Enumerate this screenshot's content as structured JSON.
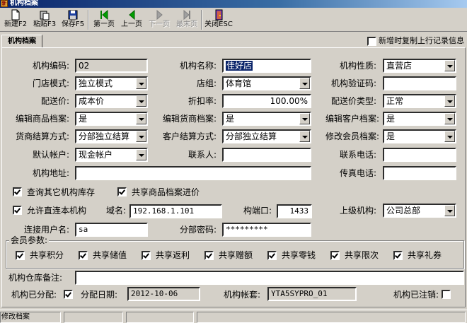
{
  "window": {
    "title": "机构档案",
    "app_icon_text": "新"
  },
  "toolbar": {
    "new": "新建F2",
    "paste": "粘贴F3",
    "save": "保存F5",
    "first": "第一页",
    "prev": "上一页",
    "next": "下一页",
    "last": "最末页",
    "close": "关闭ESC"
  },
  "tab": {
    "label": "机构档案"
  },
  "copy_prev": {
    "label": "新增时复制上行记录信息",
    "checked": false
  },
  "fields": {
    "org_code": {
      "label": "机构编码:",
      "value": "02"
    },
    "org_name": {
      "label": "机构名称:",
      "value": "佳好店"
    },
    "org_nature": {
      "label": "机构性质:",
      "value": "直营店"
    },
    "store_mode": {
      "label": "门店模式:",
      "value": "独立模式"
    },
    "store_group": {
      "label": "店组:",
      "value": "体育馆"
    },
    "org_verify": {
      "label": "机构验证码:",
      "value": ""
    },
    "dist_price": {
      "label": "配送价:",
      "value": "成本价"
    },
    "discount": {
      "label": "折扣率:",
      "value": "100.00%"
    },
    "dist_price_type": {
      "label": "配送价类型:",
      "value": "正常"
    },
    "edit_goods": {
      "label": "编辑商品档案:",
      "value": "是"
    },
    "edit_supplier": {
      "label": "编辑货商档案:",
      "value": "是"
    },
    "edit_customer": {
      "label": "编辑客户档案:",
      "value": "是"
    },
    "supplier_settle": {
      "label": "货商结算方式:",
      "value": "分部独立结算"
    },
    "customer_settle": {
      "label": "客户结算方式:",
      "value": "分部独立结算"
    },
    "edit_member": {
      "label": "修改会员档案:",
      "value": "是"
    },
    "default_account": {
      "label": "默认帐户:",
      "value": "现金帐户"
    },
    "contact": {
      "label": "联系人:",
      "value": ""
    },
    "phone": {
      "label": "联系电话:",
      "value": ""
    },
    "address": {
      "label": "机构地址:",
      "value": ""
    },
    "fax": {
      "label": "传真电话:",
      "value": ""
    }
  },
  "query_stock": {
    "label": "查询其它机构库存",
    "checked": true
  },
  "share_goods_price": {
    "label": "共享商品档案进价",
    "checked": true
  },
  "allow_connect": {
    "label": "允许直连本机构",
    "checked": true
  },
  "domain": {
    "label": "域名:",
    "value": "192.168.1.101"
  },
  "port": {
    "label": "构端口:",
    "value": "1433"
  },
  "parent_org": {
    "label": "上级机构:",
    "value": "公司总部"
  },
  "conn_user": {
    "label": "连接用户名:",
    "value": "sa"
  },
  "branch_pwd": {
    "label": "分部密码:",
    "value": "*********"
  },
  "member": {
    "title": "会员参数:",
    "options": [
      {
        "label": "共享积分",
        "checked": true
      },
      {
        "label": "共享储值",
        "checked": true
      },
      {
        "label": "共享返利",
        "checked": true
      },
      {
        "label": "共享赠额",
        "checked": true
      },
      {
        "label": "共享零钱",
        "checked": true
      },
      {
        "label": "共享限次",
        "checked": true
      },
      {
        "label": "共享礼券",
        "checked": true
      }
    ]
  },
  "warehouse_note": {
    "label": "机构仓库备注:",
    "value": ""
  },
  "allocated": {
    "label": "机构已分配:",
    "checked": true
  },
  "alloc_date": {
    "label": "分配日期:",
    "value": "2012-10-06"
  },
  "account_set": {
    "label": "机构帐套:",
    "value": "YTA5SYPRO_01"
  },
  "cancelled": {
    "label": "机构已注销:",
    "checked": false
  },
  "status": {
    "text": "修改档案"
  }
}
